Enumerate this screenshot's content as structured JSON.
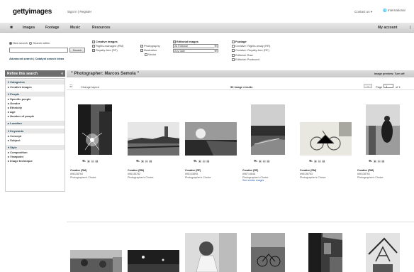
{
  "header": {
    "logo": "gettyimages",
    "signin": "Sign in | Register",
    "contact": "Contact us ▾",
    "international": "International"
  },
  "nav": {
    "items": [
      "Images",
      "Footage",
      "Music",
      "Resources"
    ],
    "my_account": "My account"
  },
  "search": {
    "new_search": "New search",
    "search_within": "Search within",
    "button": "Search",
    "links": "Advanced search | Catalyst search ideas",
    "creative_images": "Creative images",
    "rights_managed": "Rights-managed (RM)",
    "royalty_free": "Royalty-free (RF)",
    "photography": "Photography",
    "illustration": "Illustration",
    "vector": "Vector",
    "editorial_images": "Editorial images",
    "all_editorial": "All Editorial",
    "any_date": "Any date",
    "footage": "Footage",
    "creative_rights_ready": "Creative: Rights-ready (RR)",
    "creative_royalty_free": "Creative: Royalty-free (RF)",
    "editorial_raw": "Editorial: Raw",
    "editorial_produced": "Editorial: Produced"
  },
  "sidebar": {
    "title": "Refine this search",
    "sections": [
      {
        "label": "Categories",
        "items": [
          "Creative images"
        ]
      },
      {
        "label": "People",
        "items": [
          "Specific people",
          "Gender",
          "Ethnicity",
          "Age",
          "Number of people"
        ]
      },
      {
        "label": "Location",
        "items": []
      },
      {
        "label": "Keywords",
        "items": [
          "Concept",
          "Subject"
        ]
      },
      {
        "label": "Style",
        "items": [
          "Composition",
          "Viewpoint",
          "Image technique"
        ]
      }
    ]
  },
  "results": {
    "title": "\" Photographer: Marcos Semola \"",
    "preview": "Image preview: Turn off",
    "change_layout": "Change layout",
    "count": "50 image results",
    "page_label": "Page",
    "page_num": "1",
    "of": "of 1",
    "items": [
      {
        "line1": "Creative (RM)",
        "line2": "#96138764",
        "line3": "Photographer's Choice",
        "extra": ""
      },
      {
        "line1": "Creative (RM)",
        "line2": "#96138762",
        "line3": "Photographer's Choice",
        "extra": ""
      },
      {
        "line1": "Creative (RF)",
        "line2": "#95143895",
        "line3": "Photographer's Choice",
        "extra": ""
      },
      {
        "line1": "Creative (RF)",
        "line2": "#96714648",
        "line3": "Photographer's Choice",
        "extra": "See similar images"
      },
      {
        "line1": "Creative (RM)",
        "line2": "#96138763",
        "line3": "Photographer's Choice",
        "extra": ""
      },
      {
        "line1": "Creative (RM)",
        "line2": "#96138761",
        "line3": "Photographer's Choice",
        "extra": ""
      }
    ]
  }
}
